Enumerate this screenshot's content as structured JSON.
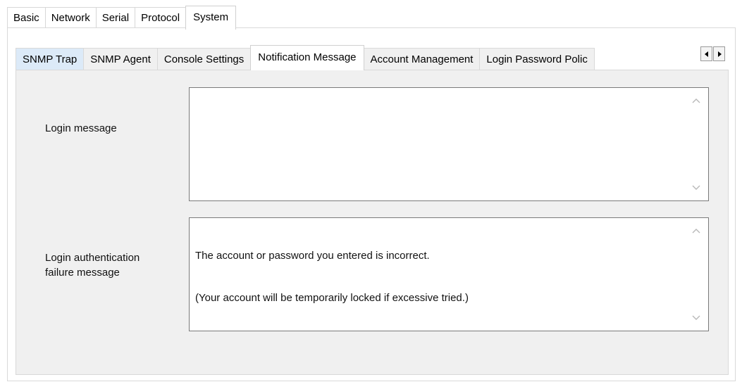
{
  "top_tabs": [
    {
      "label": "Basic"
    },
    {
      "label": "Network"
    },
    {
      "label": "Serial"
    },
    {
      "label": "Protocol"
    },
    {
      "label": "System",
      "active": true
    }
  ],
  "inner_tabs": [
    {
      "label": "SNMP Trap"
    },
    {
      "label": "SNMP Agent"
    },
    {
      "label": "Console Settings"
    },
    {
      "label": "Notification Message",
      "active": true
    },
    {
      "label": "Account Management"
    },
    {
      "label": "Login Password Polic"
    }
  ],
  "tab_scroll": {
    "left_icon": "arrow-left-icon",
    "right_icon": "arrow-right-icon"
  },
  "fields": {
    "login_message": {
      "label": "Login message",
      "value": ""
    },
    "login_failure_message": {
      "label_line1": "Login authentication",
      "label_line2": "failure message",
      "value_line1": "The account or password you entered is incorrect.",
      "value_line2": "(Your account will be temporarily locked if excessive tried.)"
    }
  },
  "colors": {
    "panel_background": "#f0f0f0",
    "selected_tab_tint": "#dceaf8",
    "textbox_border": "#7a7a7a"
  }
}
